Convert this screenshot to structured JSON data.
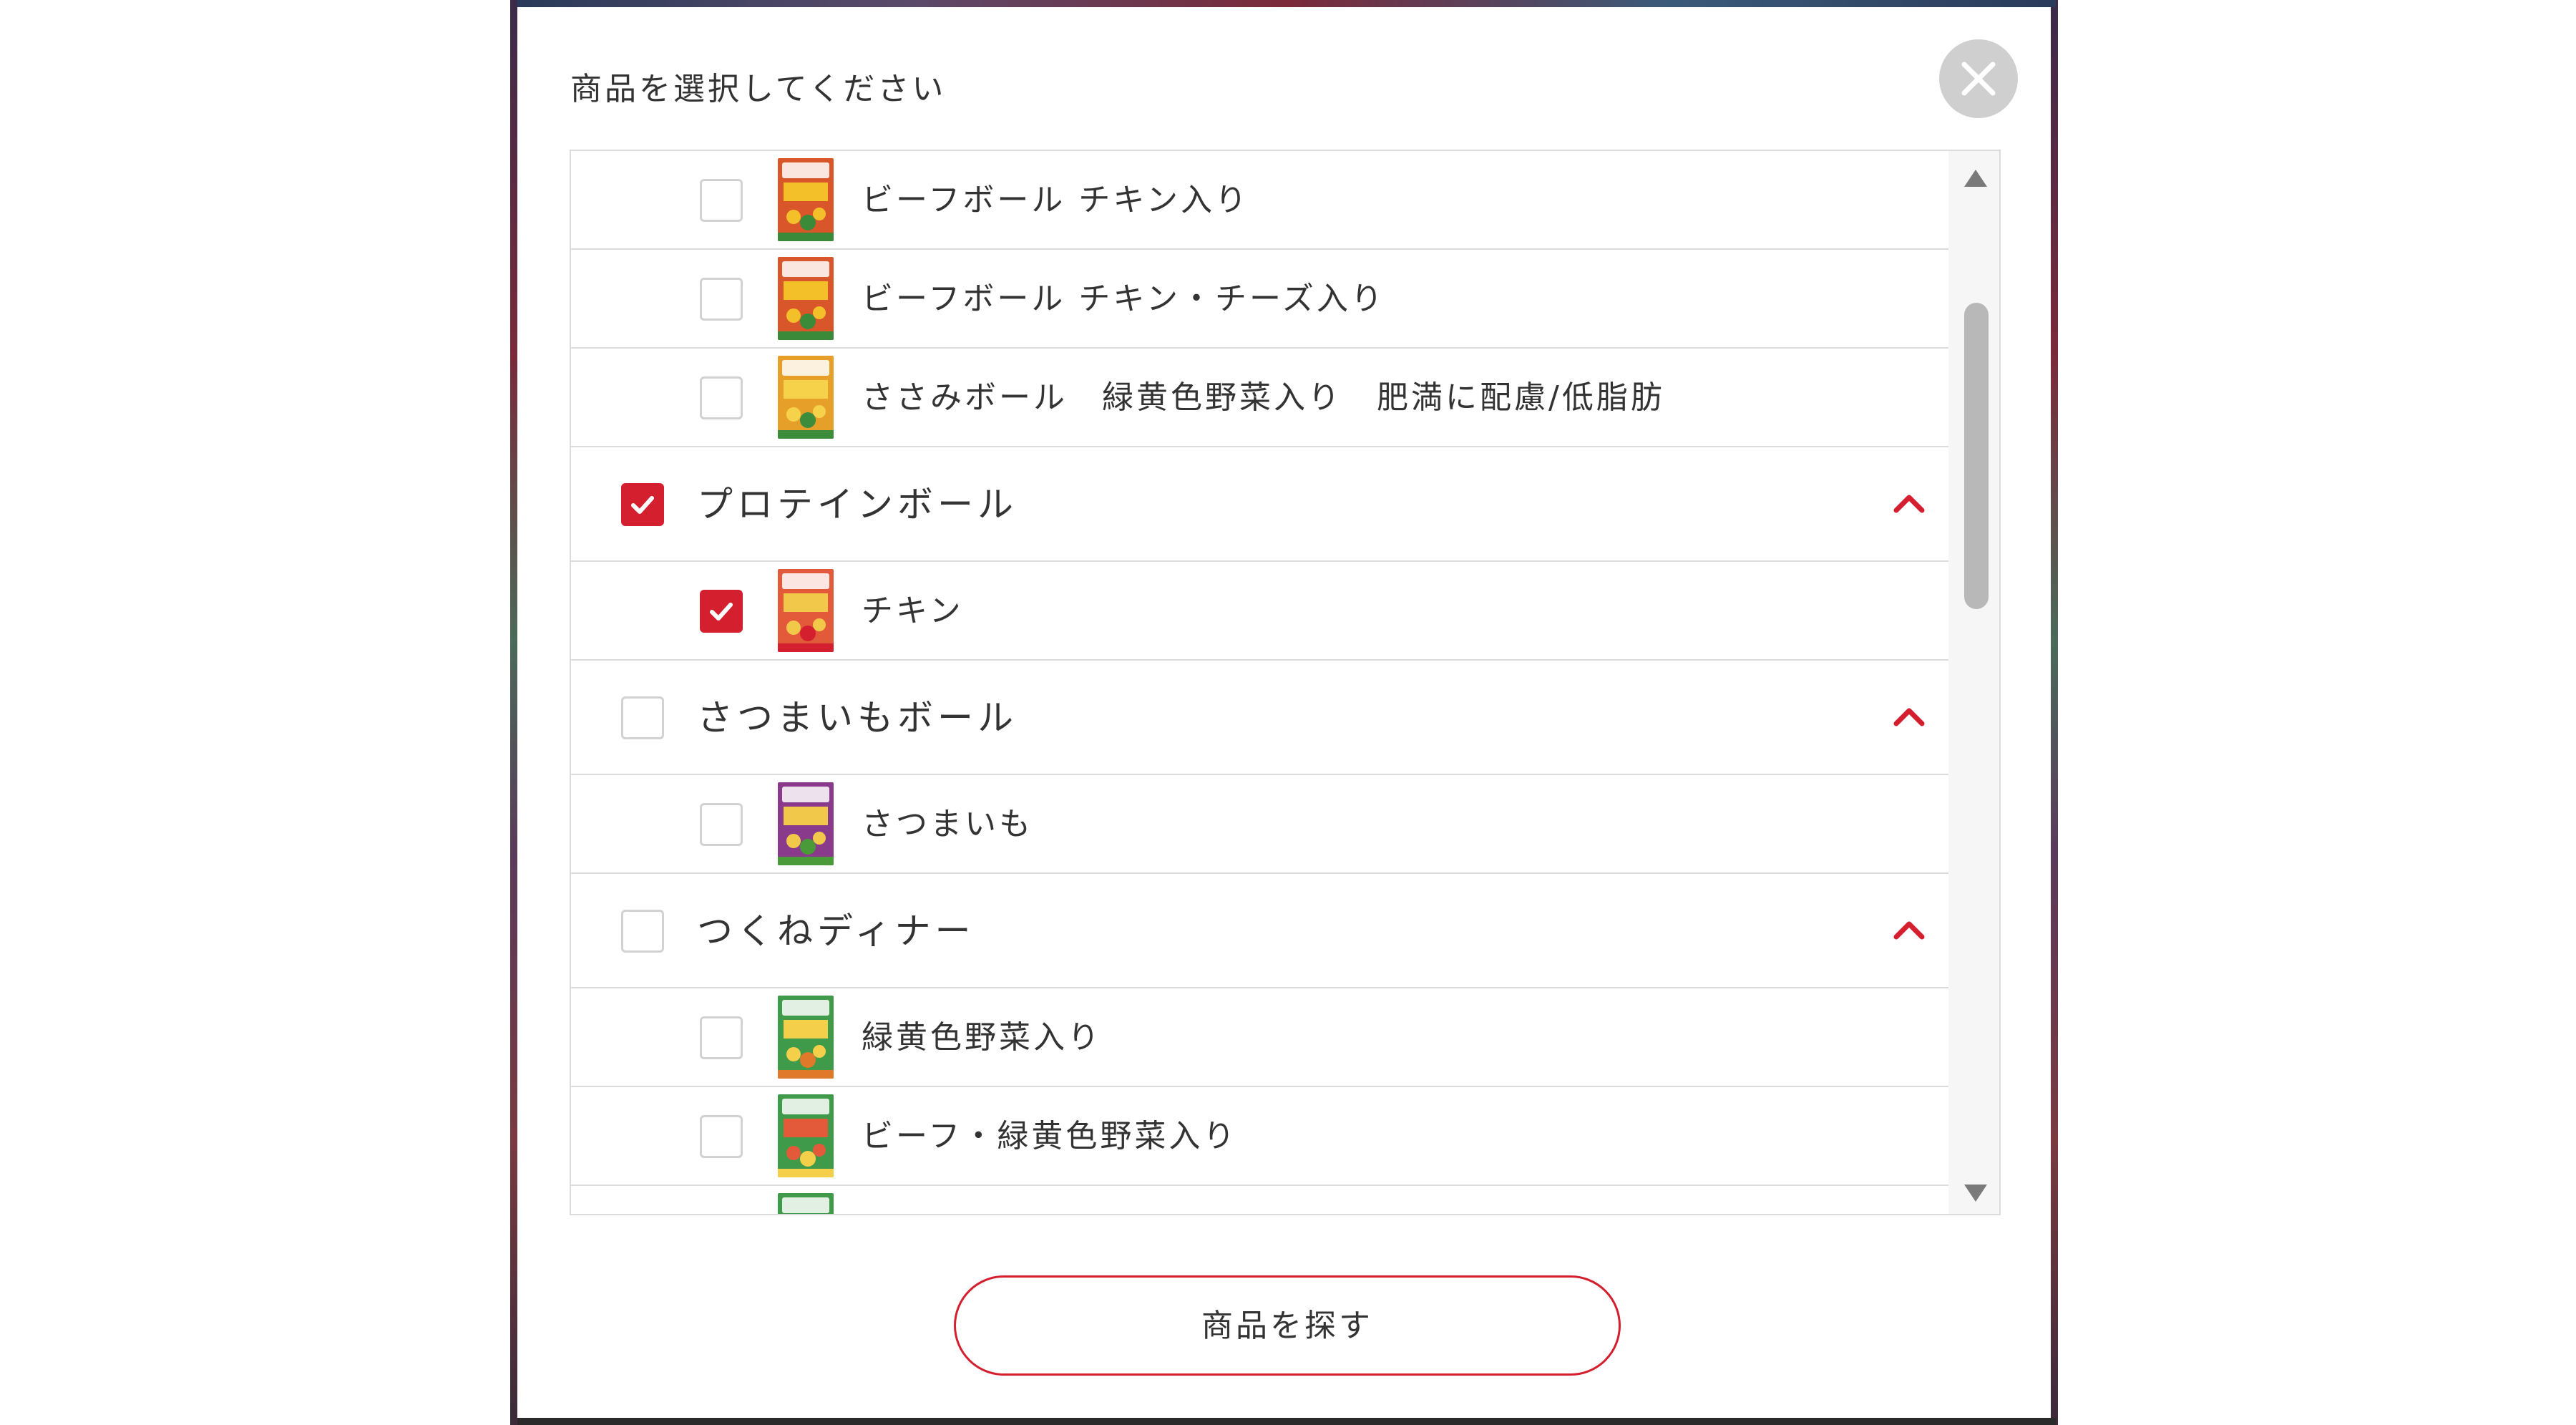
{
  "modal": {
    "title": "商品を選択してください",
    "search_button_label": "商品を探す"
  },
  "colors": {
    "accent": "#d4202e",
    "border": "#dcdcdc",
    "close_bg": "#cfcfcf",
    "scroll_thumb": "#b8b8b8"
  },
  "rows": [
    {
      "type": "child",
      "label": "ビーフボール チキン入り",
      "checked": false,
      "thumb": "beef-ball-package"
    },
    {
      "type": "child",
      "label": "ビーフボール チキン・チーズ入り",
      "checked": false,
      "thumb": "beef-ball-package"
    },
    {
      "type": "child",
      "label": "ささみボール　緑黄色野菜入り　肥満に配慮/低脂肪",
      "checked": false,
      "thumb": "sasami-ball-package"
    },
    {
      "type": "parent",
      "label": "プロテインボール",
      "checked": true,
      "expanded": true
    },
    {
      "type": "child",
      "label": "チキン",
      "checked": true,
      "thumb": "protein-ball-package"
    },
    {
      "type": "parent",
      "label": "さつまいもボール",
      "checked": false,
      "expanded": true
    },
    {
      "type": "child",
      "label": "さつまいも",
      "checked": false,
      "thumb": "satsumaimo-package"
    },
    {
      "type": "parent",
      "label": "つくねディナー",
      "checked": false,
      "expanded": true
    },
    {
      "type": "child",
      "label": "緑黄色野菜入り",
      "checked": false,
      "thumb": "tsukune-package"
    },
    {
      "type": "child",
      "label": "ビーフ・緑黄色野菜入り",
      "checked": false,
      "thumb": "tsukune-beef-package"
    },
    {
      "type": "child",
      "label": "",
      "checked": false,
      "thumb": "tsukune-package"
    }
  ]
}
